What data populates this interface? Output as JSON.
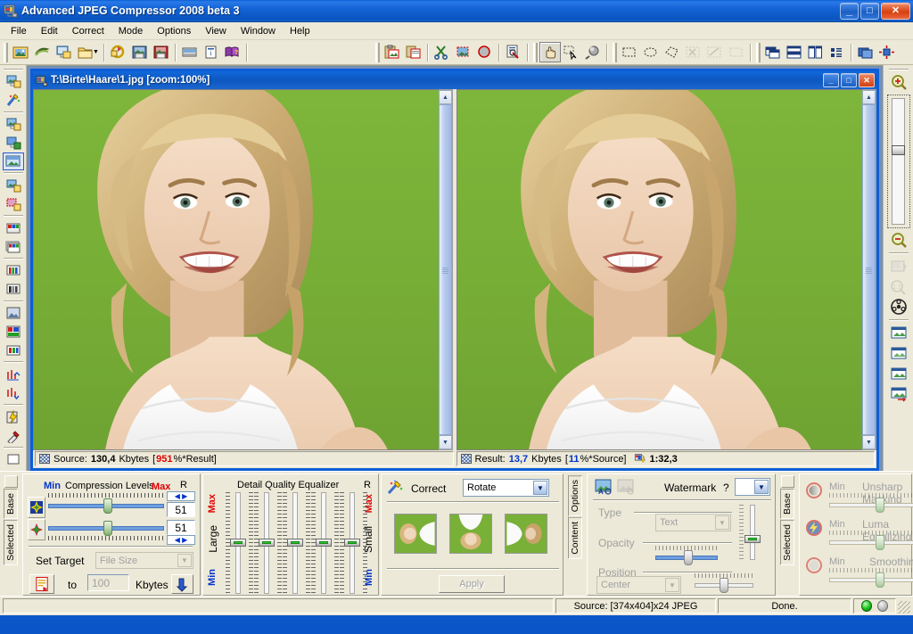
{
  "window": {
    "title": "Advanced JPEG Compressor 2008 beta 3",
    "icon": "app-icon",
    "minimize": "_",
    "maximize": "□",
    "close": "✕"
  },
  "menu": {
    "items": [
      {
        "label": "File"
      },
      {
        "label": "Edit"
      },
      {
        "label": "Correct"
      },
      {
        "label": "Mode"
      },
      {
        "label": "Options"
      },
      {
        "label": "View"
      },
      {
        "label": "Window"
      },
      {
        "label": "Help"
      }
    ]
  },
  "toolbar": {
    "groups": [
      {
        "buttons": [
          {
            "name": "open-image-icon"
          },
          {
            "name": "acquire-scanner-icon"
          },
          {
            "name": "open-from-screen-icon"
          },
          {
            "name": "open-folder-icon",
            "dropdown": true
          },
          {
            "name": "reload-image-icon"
          },
          {
            "name": "save-image-icon"
          },
          {
            "name": "save-as-icon"
          },
          {
            "name": "batch-icon"
          },
          {
            "name": "info-icon"
          },
          {
            "name": "help-book-icon"
          }
        ]
      },
      {
        "buttons": [
          {
            "name": "paste-icon"
          },
          {
            "name": "copy-icon"
          },
          {
            "name": "cut-icon"
          },
          {
            "name": "crop-icon"
          },
          {
            "name": "deselect-icon"
          },
          {
            "name": "preview-icon"
          }
        ]
      },
      {
        "buttons": [
          {
            "name": "pan-hand-icon",
            "pressed": true
          },
          {
            "name": "select-arrow-icon"
          },
          {
            "name": "magic-wand-icon"
          }
        ]
      },
      {
        "buttons": [
          {
            "name": "rect-select-icon"
          },
          {
            "name": "ellipse-select-icon"
          },
          {
            "name": "polygon-select-icon"
          },
          {
            "name": "scissors-icon",
            "disabled": true
          },
          {
            "name": "scissors-alt-icon",
            "disabled": true
          },
          {
            "name": "clear-selection-icon",
            "disabled": true
          }
        ]
      },
      {
        "buttons": [
          {
            "name": "cascade-windows-icon"
          },
          {
            "name": "tile-horizontal-icon"
          },
          {
            "name": "tile-vertical-icon"
          },
          {
            "name": "arrange-icons-icon"
          },
          {
            "name": "new-window-icon"
          },
          {
            "name": "center-image-icon"
          }
        ]
      }
    ]
  },
  "left_toolbar": {
    "buttons": [
      {
        "name": "open-image-side-icon"
      },
      {
        "name": "magic-correct-icon"
      },
      {
        "name": "image-save-icon"
      },
      {
        "name": "image-export-icon"
      },
      {
        "name": "image-window-icon",
        "active": true
      },
      {
        "name": "image-props-icon"
      },
      {
        "name": "image-select-icon"
      },
      {
        "name": "palette-icon"
      },
      {
        "name": "palette-grid-icon"
      },
      {
        "name": "channels-icon"
      },
      {
        "name": "bw-channels-icon"
      },
      {
        "name": "thumbnail-icon"
      },
      {
        "name": "color-table-icon"
      },
      {
        "name": "rgb-bars-icon"
      },
      {
        "name": "histogram-up-icon"
      },
      {
        "name": "histogram-down-icon"
      },
      {
        "name": "lightning-icon"
      },
      {
        "name": "eyedropper-icon"
      }
    ]
  },
  "right_toolbar": {
    "zoom_in": "zoom-in-icon",
    "zoom_out": "zoom-out-icon",
    "buttons": [
      {
        "name": "fit-window-icon",
        "disabled": true
      },
      {
        "name": "zoom-100-icon",
        "disabled": true
      },
      {
        "name": "film-reel-icon"
      },
      {
        "name": "window-view-1-icon"
      },
      {
        "name": "window-view-2-icon"
      },
      {
        "name": "window-view-3-icon"
      },
      {
        "name": "window-view-add-icon"
      }
    ],
    "zoom_slider_value": 72
  },
  "document": {
    "title": "T:\\Birte\\Haare\\1.jpg  [zoom:100%]",
    "minimize": "_",
    "maximize": "□",
    "close": "✕",
    "source_status": {
      "prefix": "Source:",
      "size": "130,4",
      "unit": "Kbytes",
      "ratio_open": "[",
      "ratio": "951",
      "ratio_tail": "%*Result]"
    },
    "result_status": {
      "prefix": "Result:",
      "size": "13,7",
      "unit": "Kbytes",
      "ratio_open": "[",
      "ratio": "11",
      "ratio_tail": "%*Source]",
      "compress_ratio": "1:32,3"
    }
  },
  "panels": {
    "left_tabs": [
      {
        "label": "Base"
      },
      {
        "label": "Selected"
      }
    ],
    "compression": {
      "title": "Compression Levels",
      "min_label": "Min",
      "max_label": "Max",
      "r_label": "R",
      "slider1_value": "51",
      "slider2_value": "51",
      "set_target_label": "Set Target",
      "target_mode": "File Size",
      "to_label": "to",
      "target_value": "100",
      "target_unit": "Kbytes",
      "target_icon": "target-file-icon",
      "apply_icon": "apply-target-icon",
      "slider1_icon": "quality-star-icon",
      "slider2_icon": "chroma-star-icon"
    },
    "dqe": {
      "title": "Detail Quality Equalizer",
      "r_label": "R",
      "max_label": "Max",
      "min_label": "Min",
      "large_label": "Large",
      "small_label": "Small",
      "slider_count": 5,
      "values": [
        50,
        50,
        50,
        50,
        50
      ]
    },
    "correct": {
      "title": "Correct",
      "icon": "correct-wand-icon",
      "mode": "Rotate",
      "apply_label": "Apply",
      "thumbnails": [
        "rotate-left-thumb",
        "rotate-none-thumb",
        "rotate-right-thumb"
      ]
    },
    "watermark": {
      "title": "Watermark",
      "help": "?",
      "icon_text": "watermark-text-icon",
      "icon_image": "watermark-image-icon",
      "type_label": "Type",
      "type_value": "Text",
      "opacity_label": "Opacity",
      "position_label": "Position",
      "position_value": "Center",
      "tabs": [
        {
          "label": "Options"
        },
        {
          "label": "Content"
        }
      ]
    },
    "enhance": {
      "tabs": [
        {
          "label": "Base"
        },
        {
          "label": "Selected"
        }
      ],
      "rows": [
        {
          "title": "Unsharp Masking",
          "min_label": "Min",
          "icon": "unsharp-icon"
        },
        {
          "title": "Luma Equalizing",
          "min_label": "Min",
          "icon": "luma-icon"
        },
        {
          "title": "Smoothing",
          "min_label": "Min",
          "icon": "smoothing-icon"
        }
      ]
    }
  },
  "statusbar": {
    "source_info": "Source: [374x404]x24 JPEG",
    "progress_text": "Done.",
    "led_on": "status-led-green",
    "led_off": "status-led-gray"
  },
  "colors": {
    "title_blue": "#0a56c8",
    "face": "#ece9d8",
    "min_blue": "#0033cc",
    "max_red": "#e00000",
    "led_green": "#18c018"
  }
}
